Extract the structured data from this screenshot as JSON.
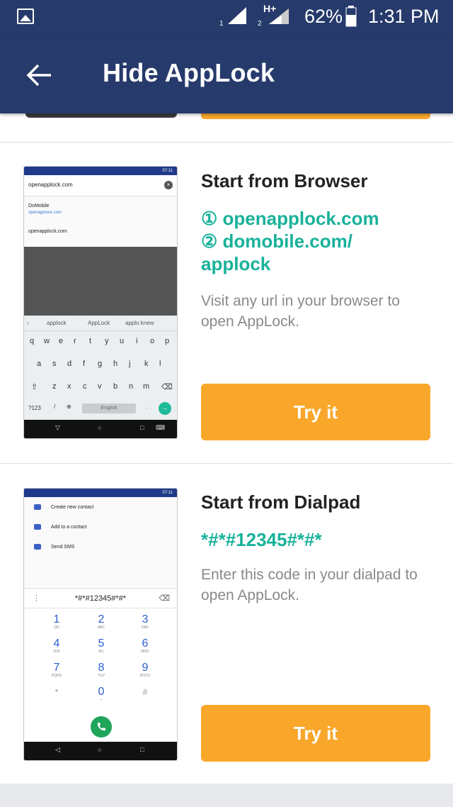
{
  "status_bar": {
    "sim1_label": "1",
    "sim2_label": "2",
    "network_type": "H+",
    "battery": "62%",
    "time": "1:31 PM",
    "icons": [
      "image-icon",
      "signal-icon",
      "signal-icon",
      "battery-icon"
    ]
  },
  "app_bar": {
    "title": "Hide AppLock",
    "back_icon": "arrow-left-icon"
  },
  "cards": [
    {
      "title": "Start from Browser",
      "accent_lines": [
        "① openapplock.com",
        "② domobile.com/",
        "applock"
      ],
      "description": "Visit any url in your browser to open AppLock.",
      "button": "Try it",
      "preview": {
        "status_time": "07:11",
        "url": "openapplock.com",
        "suggestion_title": "DoMobile",
        "suggestion_url": "openapplock.com",
        "suggestion_2": "openapplock.com",
        "keyboard_suggestions": [
          "applock",
          "AppLock",
          "applo knew"
        ],
        "row1": [
          "q",
          "w",
          "e",
          "r",
          "t",
          "y",
          "u",
          "i",
          "o",
          "p"
        ],
        "row2": [
          "a",
          "s",
          "d",
          "f",
          "g",
          "h",
          "j",
          "k",
          "l"
        ],
        "row3": [
          "z",
          "x",
          "c",
          "v",
          "b",
          "n",
          "m"
        ],
        "space_label": "English",
        "numkey": "?123"
      }
    },
    {
      "title": "Start from Dialpad",
      "accent_lines": [
        "*#*#12345#*#*"
      ],
      "description": "Enter this code in your dialpad to open AppLock.",
      "button": "Try it",
      "preview": {
        "status_time": "07:11",
        "menu": [
          "Create new contact",
          "Add to a contact",
          "Send SMS"
        ],
        "dial_input": "*#*#12345#*#*",
        "keys": [
          {
            "d": "1",
            "l": "QO"
          },
          {
            "d": "2",
            "l": "ABC"
          },
          {
            "d": "3",
            "l": "DEF"
          },
          {
            "d": "4",
            "l": "GHI"
          },
          {
            "d": "5",
            "l": "JKL"
          },
          {
            "d": "6",
            "l": "MNO"
          },
          {
            "d": "7",
            "l": "PQRS"
          },
          {
            "d": "8",
            "l": "TUV"
          },
          {
            "d": "9",
            "l": "WXYZ"
          },
          {
            "d": "*",
            "l": ""
          },
          {
            "d": "0",
            "l": "+"
          },
          {
            "d": "#",
            "l": ""
          }
        ]
      }
    }
  ],
  "colors": {
    "app_bar": "#263a6b",
    "accent": "#18b29a",
    "button": "#f9a72b"
  }
}
